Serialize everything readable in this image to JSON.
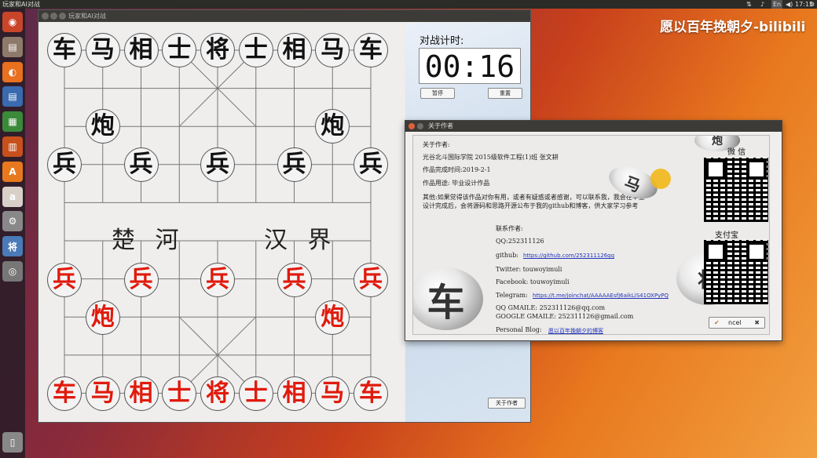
{
  "os": {
    "window_title": "玩家和AI对战",
    "indicators": [
      "⇅",
      "♪",
      "En",
      "◀)",
      "17:15",
      "⚙"
    ],
    "watermark": "愿以百年挽朝夕-bilibili"
  },
  "launcher": {
    "items": [
      {
        "name": "ubuntu-dash-icon",
        "glyph": "◉",
        "color": "#c8452a"
      },
      {
        "name": "files-icon",
        "glyph": "▤",
        "color": "#8d7a6a"
      },
      {
        "name": "firefox-icon",
        "glyph": "◐",
        "color": "#e8701e"
      },
      {
        "name": "writer-icon",
        "glyph": "▤",
        "color": "#3a6ab0"
      },
      {
        "name": "calc-icon",
        "glyph": "▦",
        "color": "#3a8a3a"
      },
      {
        "name": "impress-icon",
        "glyph": "▥",
        "color": "#c8501c"
      },
      {
        "name": "software-center-icon",
        "glyph": "A",
        "color": "#e8781e"
      },
      {
        "name": "amazon-icon",
        "glyph": "a",
        "color": "#d8d0c8"
      },
      {
        "name": "settings-icon",
        "glyph": "⚙",
        "color": "#888"
      },
      {
        "name": "chess-app-icon",
        "glyph": "将",
        "color": "#4a7ab8"
      },
      {
        "name": "dvd-icon",
        "glyph": "◎",
        "color": "#777"
      },
      {
        "name": "trash-icon",
        "glyph": "▯",
        "color": "#888"
      }
    ]
  },
  "game": {
    "title": "玩家和AI对战",
    "river_left": "楚 河",
    "river_right": "汉 界",
    "black_pieces": [
      "车",
      "马",
      "相",
      "士",
      "将",
      "士",
      "相",
      "马",
      "车",
      "炮",
      "炮",
      "兵",
      "兵",
      "兵",
      "兵",
      "兵"
    ],
    "red_pieces": [
      "兵",
      "兵",
      "兵",
      "兵",
      "兵",
      "炮",
      "炮",
      "车",
      "马",
      "相",
      "士",
      "将",
      "士",
      "相",
      "马",
      "车"
    ],
    "timer_label": "对战计时:",
    "timer_value": "00:16",
    "pause_button": "暂停",
    "restart_button": "重置",
    "about_button": "关于作者"
  },
  "about_dialog": {
    "title": "关于作者",
    "author_heading": "关于作者:",
    "school": "光谷北斗国际学院 2015级软件工程(1)班 张文耕",
    "completion": "作品完成时间:2019-2-1",
    "purpose": "作品用途: 毕业设计作品",
    "other_line1": "其他:如果觉得该作品对你有用，或者有疑惑或者感谢，可以联系我，我会在毕业",
    "other_line2": "设计完成后，会将源码和思路开源公布于我的github和博客，供大家学习参考",
    "contact_heading": "联系作者:",
    "qq": "QQ:252311126",
    "github_label": "github:",
    "github_link": "https://github.com/252311126qq",
    "twitter": "Twitter: touwoyimuli",
    "facebook": "Facebook: touwoyimuli",
    "telegram_label": "Telegram:",
    "telegram_link": "https://t.me/joinchat/AAAAAEsfJ6aikLiS41OXPyPQ",
    "qq_gmail": "QQ GMAILE: 252311126@qq.com",
    "google_gmail": "GOOGLE GMAILE: 252311126@gmail.com",
    "blog_label": "Personal Blog:",
    "blog_link": "愿以百年挽朝夕的博客",
    "wechat_label": "微 信",
    "alipay_label": "支付宝",
    "ok_button": "ncel"
  }
}
